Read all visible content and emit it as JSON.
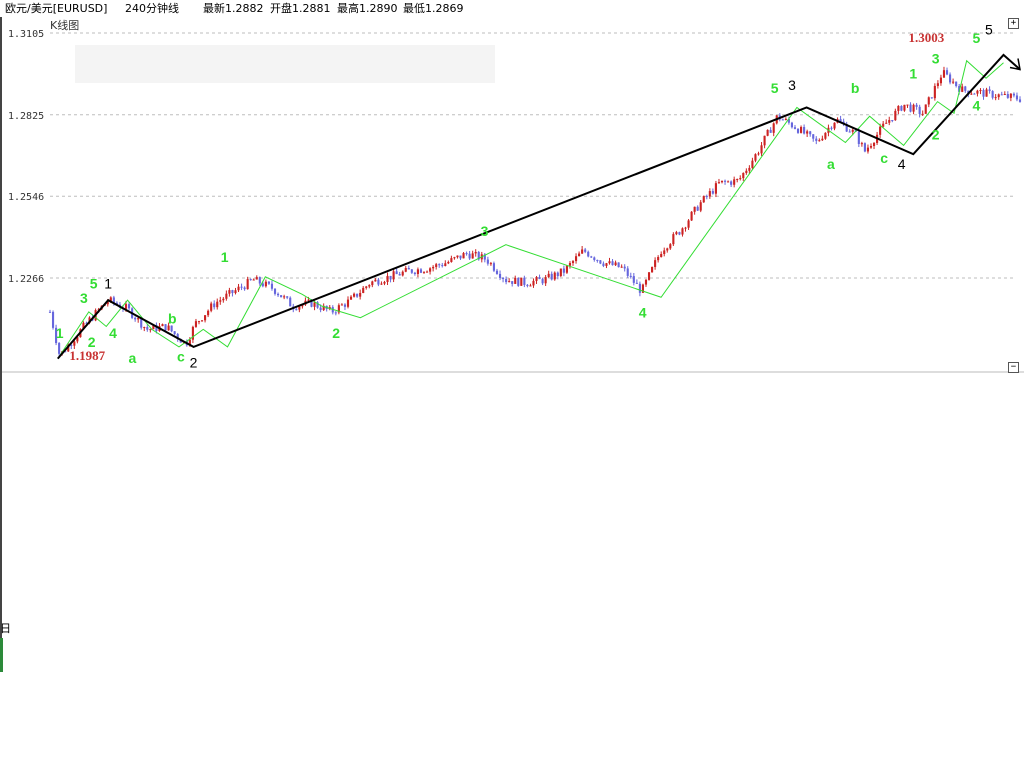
{
  "header": {
    "symbol": "欧元/美元[EURUSD]",
    "period": "240分钟线",
    "latest": "最新1.2882",
    "open": "开盘1.2881",
    "high": "最高1.2890",
    "low": "最低1.2869"
  },
  "panel": {
    "chart_type_label": "K线图",
    "expand_button": "+",
    "collapse_button": "−",
    "side_glyph": "日"
  },
  "chart_data": {
    "type": "candlestick",
    "y_axis": {
      "ticks": [
        "1.3105",
        "1.2825",
        "1.2546",
        "1.2266"
      ],
      "tick_values": [
        1.3105,
        1.2825,
        1.2546,
        1.2266
      ],
      "range": [
        1.194,
        1.3105
      ],
      "grid": "dashed-horizontal"
    },
    "colors": {
      "up": "#cc2222",
      "down": "#6666dd",
      "minor_wave": "#33dd33",
      "major_wave": "#000000",
      "price_annotation": "#c83232"
    },
    "price_path": [
      [
        0.0,
        1.215
      ],
      [
        0.01,
        1.2
      ],
      [
        0.04,
        1.212
      ],
      [
        0.06,
        1.219
      ],
      [
        0.08,
        1.216
      ],
      [
        0.1,
        1.209
      ],
      [
        0.12,
        1.21
      ],
      [
        0.14,
        1.204
      ],
      [
        0.15,
        1.211
      ],
      [
        0.17,
        1.218
      ],
      [
        0.19,
        1.222
      ],
      [
        0.21,
        1.226
      ],
      [
        0.23,
        1.223
      ],
      [
        0.25,
        1.217
      ],
      [
        0.27,
        1.218
      ],
      [
        0.29,
        1.215
      ],
      [
        0.31,
        1.219
      ],
      [
        0.33,
        1.225
      ],
      [
        0.35,
        1.227
      ],
      [
        0.37,
        1.229
      ],
      [
        0.39,
        1.23
      ],
      [
        0.41,
        1.232
      ],
      [
        0.43,
        1.235
      ],
      [
        0.45,
        1.233
      ],
      [
        0.47,
        1.226
      ],
      [
        0.49,
        1.225
      ],
      [
        0.51,
        1.226
      ],
      [
        0.53,
        1.229
      ],
      [
        0.55,
        1.236
      ],
      [
        0.57,
        1.232
      ],
      [
        0.59,
        1.23
      ],
      [
        0.61,
        1.222
      ],
      [
        0.63,
        1.236
      ],
      [
        0.65,
        1.243
      ],
      [
        0.67,
        1.252
      ],
      [
        0.69,
        1.259
      ],
      [
        0.71,
        1.26
      ],
      [
        0.73,
        1.27
      ],
      [
        0.75,
        1.282
      ],
      [
        0.77,
        1.278
      ],
      [
        0.79,
        1.273
      ],
      [
        0.81,
        1.281
      ],
      [
        0.83,
        1.276
      ],
      [
        0.84,
        1.27
      ],
      [
        0.86,
        1.279
      ],
      [
        0.88,
        1.286
      ],
      [
        0.9,
        1.283
      ],
      [
        0.92,
        1.297
      ],
      [
        0.94,
        1.291
      ],
      [
        0.96,
        1.29
      ],
      [
        0.98,
        1.289
      ],
      [
        1.0,
        1.288
      ]
    ],
    "minor_wave_path": [
      [
        0.008,
        1.199
      ],
      [
        0.04,
        1.215
      ],
      [
        0.058,
        1.21
      ],
      [
        0.08,
        1.219
      ],
      [
        0.105,
        1.209
      ],
      [
        0.133,
        1.203
      ],
      [
        0.158,
        1.209
      ],
      [
        0.183,
        1.203
      ],
      [
        0.222,
        1.227
      ],
      [
        0.26,
        1.221
      ],
      [
        0.28,
        1.217
      ],
      [
        0.32,
        1.213
      ],
      [
        0.47,
        1.238
      ],
      [
        0.63,
        1.22
      ],
      [
        0.77,
        1.285
      ],
      [
        0.82,
        1.273
      ],
      [
        0.845,
        1.282
      ],
      [
        0.88,
        1.272
      ],
      [
        0.915,
        1.287
      ],
      [
        0.932,
        1.283
      ],
      [
        0.945,
        1.301
      ],
      [
        0.965,
        1.295
      ],
      [
        0.983,
        1.3003
      ]
    ],
    "major_wave_path": [
      [
        0.008,
        1.199
      ],
      [
        0.06,
        1.219
      ],
      [
        0.148,
        1.203
      ],
      [
        0.78,
        1.285
      ],
      [
        0.89,
        1.269
      ],
      [
        0.983,
        1.303
      ],
      [
        1.0,
        1.298
      ]
    ],
    "wave_labels": [
      {
        "text": "1",
        "x": 0.01,
        "y": 1.206,
        "style": "green"
      },
      {
        "text": "3",
        "x": 0.035,
        "y": 1.218,
        "style": "green"
      },
      {
        "text": "2",
        "x": 0.043,
        "y": 1.203,
        "style": "green"
      },
      {
        "text": "5",
        "x": 0.045,
        "y": 1.223,
        "style": "green"
      },
      {
        "text": "4",
        "x": 0.065,
        "y": 1.206,
        "style": "green"
      },
      {
        "text": "a",
        "x": 0.085,
        "y": 1.1975,
        "style": "green"
      },
      {
        "text": "b",
        "x": 0.126,
        "y": 1.211,
        "style": "green"
      },
      {
        "text": "c",
        "x": 0.135,
        "y": 1.198,
        "style": "green"
      },
      {
        "text": "1",
        "x": 0.18,
        "y": 1.232,
        "style": "green"
      },
      {
        "text": "2",
        "x": 0.295,
        "y": 1.206,
        "style": "green"
      },
      {
        "text": "3",
        "x": 0.448,
        "y": 1.241,
        "style": "green"
      },
      {
        "text": "4",
        "x": 0.611,
        "y": 1.213,
        "style": "green"
      },
      {
        "text": "5",
        "x": 0.747,
        "y": 1.29,
        "style": "green"
      },
      {
        "text": "a",
        "x": 0.805,
        "y": 1.264,
        "style": "green"
      },
      {
        "text": "b",
        "x": 0.83,
        "y": 1.29,
        "style": "green"
      },
      {
        "text": "c",
        "x": 0.86,
        "y": 1.266,
        "style": "green"
      },
      {
        "text": "1",
        "x": 0.89,
        "y": 1.295,
        "style": "green"
      },
      {
        "text": "2",
        "x": 0.913,
        "y": 1.274,
        "style": "green"
      },
      {
        "text": "3",
        "x": 0.913,
        "y": 1.3,
        "style": "green"
      },
      {
        "text": "4",
        "x": 0.955,
        "y": 1.284,
        "style": "green"
      },
      {
        "text": "5",
        "x": 0.955,
        "y": 1.307,
        "style": "green"
      },
      {
        "text": "1",
        "x": 0.06,
        "y": 1.223,
        "style": "black"
      },
      {
        "text": "2",
        "x": 0.148,
        "y": 1.196,
        "style": "black"
      },
      {
        "text": "3",
        "x": 0.765,
        "y": 1.291,
        "style": "black"
      },
      {
        "text": "4",
        "x": 0.878,
        "y": 1.264,
        "style": "black"
      },
      {
        "text": "5",
        "x": 0.968,
        "y": 1.31,
        "style": "black"
      }
    ],
    "price_annotations": [
      {
        "text": "1.1987",
        "x": 0.02,
        "y": 1.1985
      },
      {
        "text": "1.3003",
        "x": 0.885,
        "y": 1.3075
      }
    ]
  }
}
